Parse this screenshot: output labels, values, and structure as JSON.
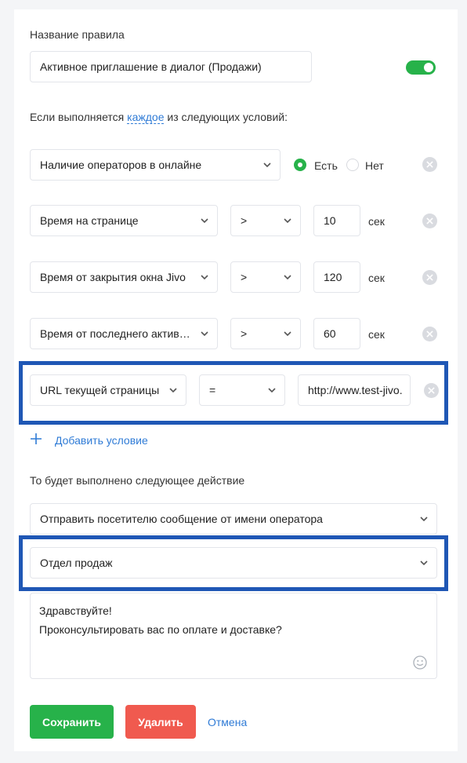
{
  "rule": {
    "name_label": "Название правила",
    "name_value": "Активное приглашение в диалог (Продажи)",
    "enabled": true
  },
  "conditions_header": {
    "prefix": "Если выполняется",
    "mode": "каждое",
    "suffix": "из следующих условий:"
  },
  "conditions": [
    {
      "field": "Наличие операторов в онлайне",
      "option_yes": "Есть",
      "option_no": "Нет",
      "selected": "Есть"
    },
    {
      "field": "Время на странице",
      "operator": ">",
      "value": "10",
      "unit": "сек"
    },
    {
      "field": "Время от закрытия окна Jivo",
      "operator": ">",
      "value": "120",
      "unit": "сек"
    },
    {
      "field": "Время от последнего активн...",
      "operator": ">",
      "value": "60",
      "unit": "сек"
    },
    {
      "field": "URL текущей страницы",
      "operator": "=",
      "value": "http://www.test-jivo."
    }
  ],
  "add_condition_label": "Добавить условие",
  "action": {
    "label": "То будет выполнено следующее действие",
    "type": "Отправить посетителю сообщение от имени оператора",
    "department": "Отдел продаж",
    "message_line1": "Здравствуйте!",
    "message_line2": "Проконсультировать вас по оплате и доставке?"
  },
  "buttons": {
    "save": "Сохранить",
    "delete": "Удалить",
    "cancel": "Отмена"
  },
  "colors": {
    "accent_green": "#27b24a",
    "delete_red": "#f05a4f",
    "link_blue": "#2f7bd6",
    "highlight_blue": "#1f57b5"
  }
}
